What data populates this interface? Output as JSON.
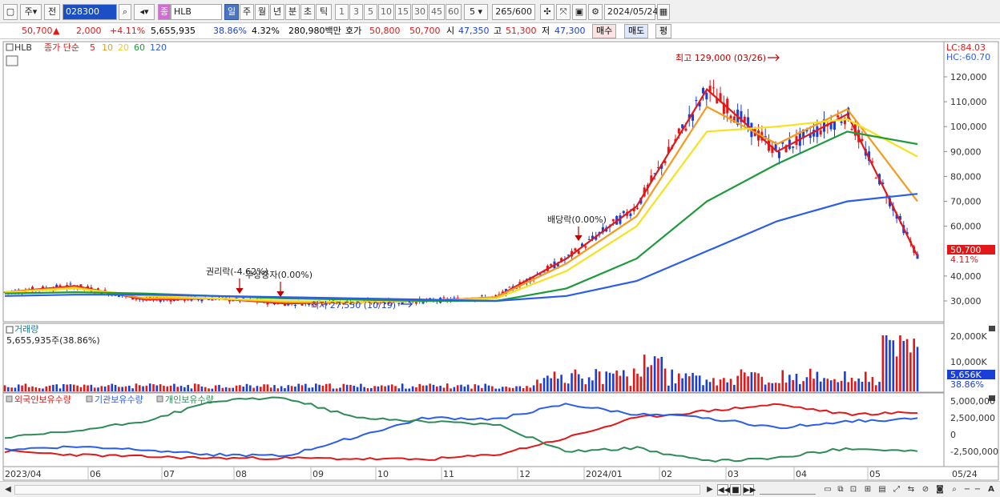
{
  "toolbar": {
    "period_label": "주",
    "prev_label": "전",
    "code": "028300",
    "stock_badge": "종",
    "stock_name": "HLB",
    "periods": [
      "일",
      "주",
      "월",
      "년",
      "분",
      "초",
      "틱"
    ],
    "active_period": "일",
    "intervals": [
      "1",
      "3",
      "5",
      "10",
      "15",
      "30",
      "45",
      "60"
    ],
    "interval_value": "5",
    "count": "265",
    "count_total": "/600",
    "date": "2024/05/24"
  },
  "quote": {
    "price": "50,700",
    "arrow": "▲",
    "change": "2,000",
    "change_pct": "+4.11%",
    "volume": "5,655,935",
    "turnover_pct": "38.86%",
    "vol_pct": "4.32%",
    "amount": "280,980백만",
    "ask_label": "호가",
    "ask1": "50,800",
    "ask2": "50,700",
    "open_label": "시",
    "open": "47,350",
    "high_label": "고",
    "high": "51,300",
    "low_label": "저",
    "low": "47,300",
    "buy_label": "매수",
    "sell_label": "매도",
    "eval_label": "평"
  },
  "price_panel": {
    "ticker": "HLB",
    "ma_title": "종가 단순",
    "ma_periods": [
      "5",
      "10",
      "20",
      "60",
      "120"
    ],
    "ma_colors": [
      "#e21818",
      "#f59a1c",
      "#f5e21c",
      "#1e9a3a",
      "#2a5ee8"
    ],
    "lc": "LC:84.03",
    "hc": "HC:-60.70",
    "y_ticks": [
      "120,000",
      "110,000",
      "100,000",
      "90,000",
      "80,000",
      "70,000",
      "60,000",
      "40,000",
      "30,000"
    ],
    "price_badge": "50,700",
    "pct_badge": "4.11%",
    "annot_high": "최고 129,000 (03/26)",
    "annot_low": "최저 27,550 (10/19)",
    "annot_rights": "권리락(-4.62%)",
    "annot_bonus": "무상증자(0.00%)",
    "annot_dividend": "배당락(0.00%)"
  },
  "volume_panel": {
    "title": "거래량",
    "value": "5,655,935주(38.86%)",
    "y_ticks": [
      "20,000K",
      "10,000K"
    ],
    "vol_badge": "5,656K",
    "pct_badge": "38.86%"
  },
  "holding_panel": {
    "series": [
      "외국인보유수량",
      "기관보유수량",
      "개인보유수량"
    ],
    "colors": [
      "#e21818",
      "#2a5ee8",
      "#2e8b57"
    ],
    "y_ticks": [
      "5,000,000",
      "2,500,000",
      "0",
      "-2,500,000"
    ]
  },
  "x_axis": {
    "labels": [
      "2023/04",
      "06",
      "07",
      "08",
      "09",
      "10",
      "11",
      "12",
      "2024/01",
      "02",
      "03",
      "04",
      "05",
      "05/24"
    ]
  },
  "chart_data": {
    "type": "line",
    "title": "HLB",
    "x": [
      "2023/04",
      "06",
      "07",
      "08",
      "09",
      "10",
      "11",
      "12",
      "2024/01",
      "02",
      "03",
      "04",
      "05",
      "05/24"
    ],
    "series": [
      {
        "name": "5",
        "values": [
          33500,
          36000,
          30500,
          31000,
          29000,
          29500,
          30000,
          31500,
          47000,
          68000,
          115000,
          90000,
          105000,
          48000
        ]
      },
      {
        "name": "10",
        "values": [
          33500,
          35500,
          31000,
          31000,
          29500,
          29500,
          30000,
          31500,
          45000,
          64000,
          108000,
          93000,
          107000,
          70000
        ]
      },
      {
        "name": "20",
        "values": [
          33500,
          35000,
          32000,
          31000,
          30000,
          29500,
          30000,
          31000,
          42000,
          60000,
          98000,
          100000,
          103000,
          88000
        ]
      },
      {
        "name": "60",
        "values": [
          33000,
          33500,
          33000,
          32000,
          31000,
          30500,
          30000,
          30000,
          35000,
          47000,
          70000,
          85000,
          98000,
          93000
        ]
      },
      {
        "name": "120",
        "values": [
          32000,
          32500,
          32500,
          32000,
          31500,
          31000,
          30500,
          30000,
          32000,
          38000,
          50000,
          62000,
          70000,
          73000
        ]
      }
    ],
    "ylim": [
      25000,
      130000
    ]
  }
}
